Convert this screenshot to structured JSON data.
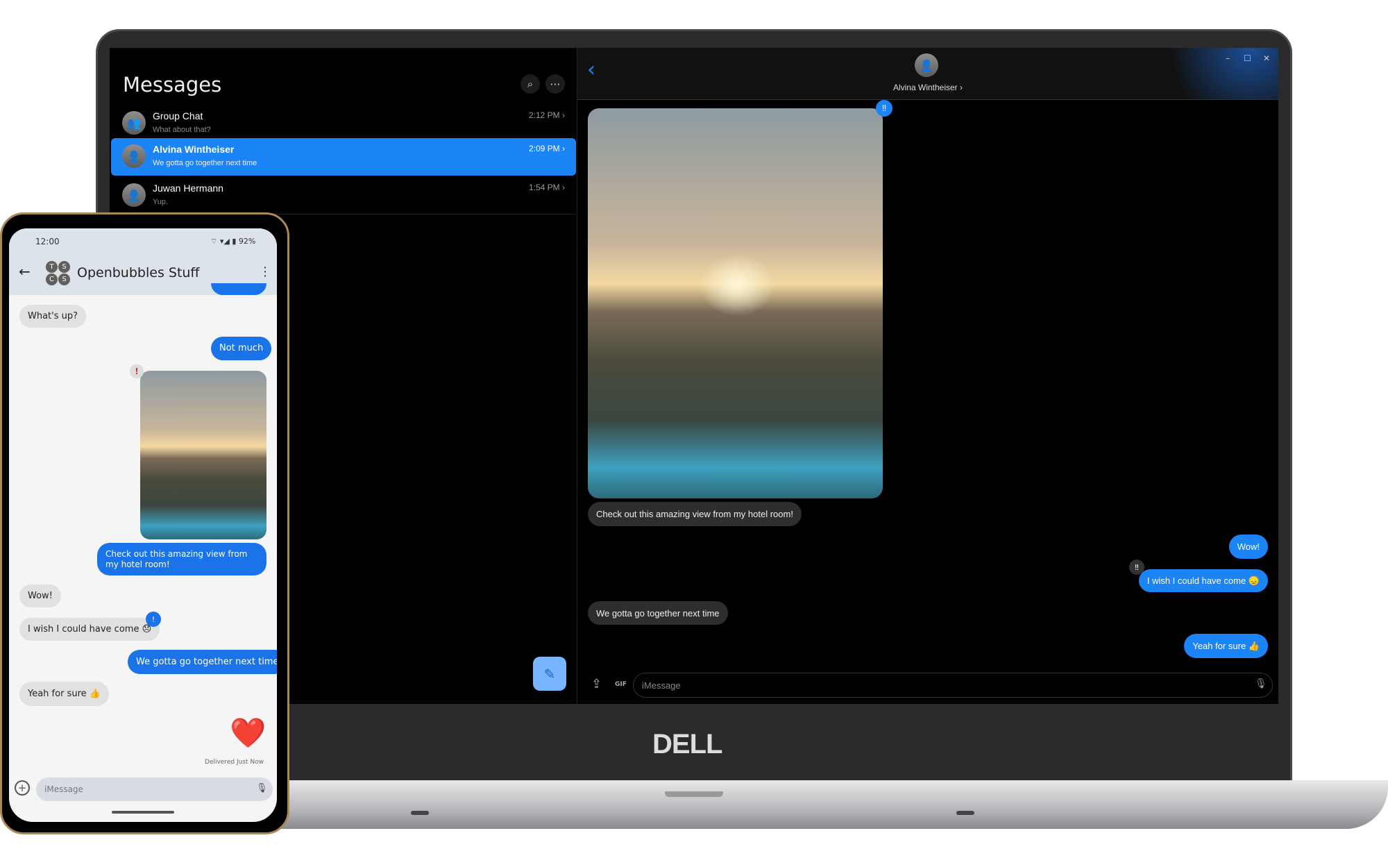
{
  "brand": "DELL",
  "desktop": {
    "sidebar": {
      "title": "Messages",
      "search_icon": "search-icon",
      "more_icon": "more-horizontal-icon",
      "conversations": [
        {
          "name": "Group Chat",
          "preview": "What about that?",
          "time": "2:12 PM",
          "selected": false
        },
        {
          "name": "Alvina Wintheiser",
          "preview": "We gotta go together next time",
          "time": "2:09 PM",
          "selected": true
        },
        {
          "name": "Juwan Hermann",
          "preview": "Yup.",
          "time": "1:54 PM",
          "selected": false
        }
      ]
    },
    "chat": {
      "contact": "Alvina Wintheiser",
      "contact_chevron": "›",
      "messages": [
        {
          "text": "Check out this amazing view from my hotel room!",
          "from": "them"
        },
        {
          "text": "Wow!",
          "from": "me"
        },
        {
          "text": "I wish I could have come 😞",
          "from": "me",
          "reaction": "‼"
        },
        {
          "text": "We gotta go together next time",
          "from": "them"
        },
        {
          "text": "Yeah for sure 👍",
          "from": "me"
        }
      ],
      "image_reaction": "‼",
      "gif_label": "GIF",
      "input_placeholder": "iMessage"
    },
    "window_controls": {
      "minimize": "–",
      "maximize": "☐",
      "close": "✕"
    },
    "accent": "#1b84f7"
  },
  "phone": {
    "status": {
      "time": "12:00",
      "battery": "92%"
    },
    "header": {
      "title": "Openbubbles Stuff",
      "avatar_letters": [
        "T",
        "S",
        "C",
        "S"
      ]
    },
    "messages": [
      {
        "text": "What's up?",
        "from": "them"
      },
      {
        "text": "Not much",
        "from": "me"
      },
      {
        "text": "Check out this amazing view from my hotel room!",
        "from": "me"
      },
      {
        "text": "Wow!",
        "from": "them"
      },
      {
        "text": "I wish I could have come 😞",
        "from": "them"
      },
      {
        "text": "We gotta go together next time",
        "from": "me"
      },
      {
        "text": "Yeah for sure 👍",
        "from": "them"
      },
      {
        "text": "❤️",
        "from": "me"
      }
    ],
    "reaction_mark": "!",
    "delivered": "Delivered Just Now",
    "input_placeholder": "iMessage",
    "accent": "#1a73e8"
  }
}
